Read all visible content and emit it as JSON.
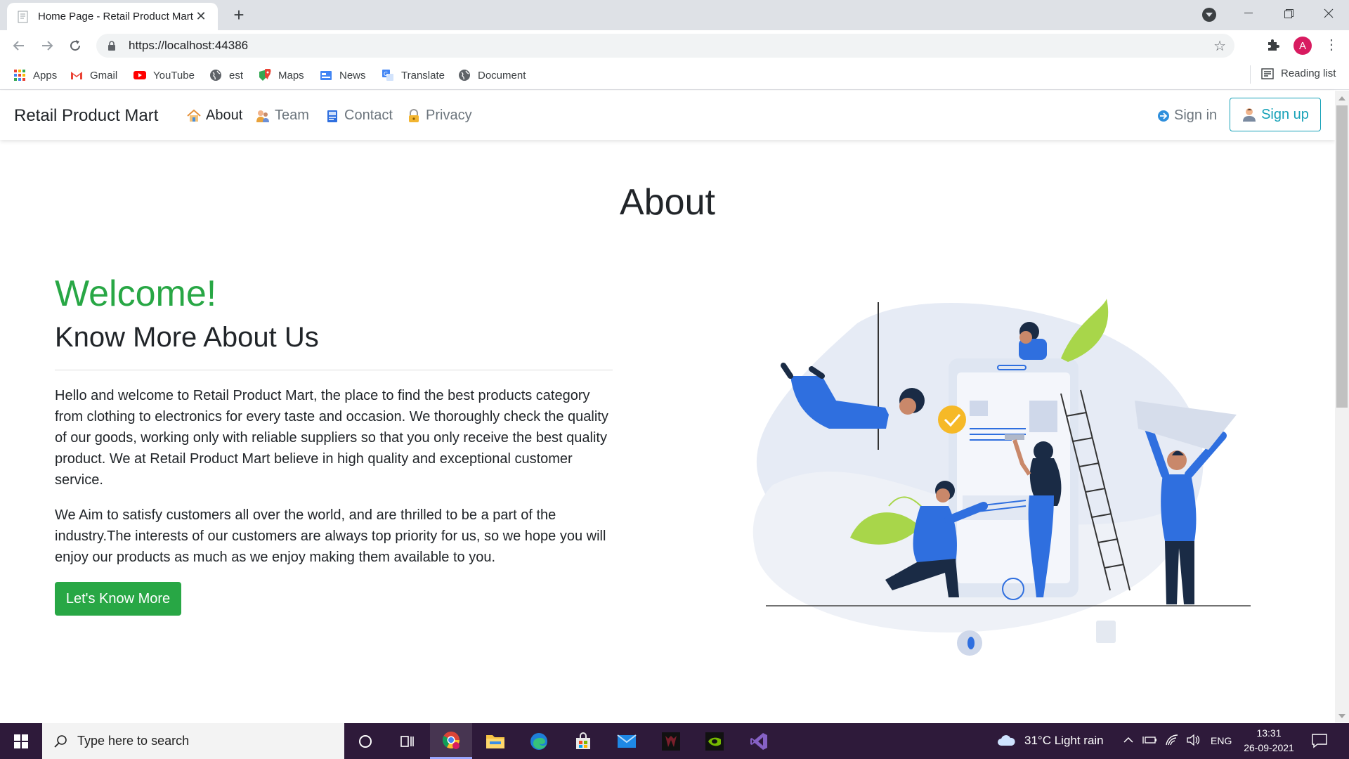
{
  "browser": {
    "tab_title": "Home Page - Retail Product Mart",
    "url": "https://localhost:44386",
    "profile_initial": "A",
    "bookmarks": [
      {
        "label": "Apps",
        "icon": "apps-grid-icon"
      },
      {
        "label": "Gmail",
        "icon": "gmail-icon"
      },
      {
        "label": "YouTube",
        "icon": "youtube-icon"
      },
      {
        "label": "est",
        "icon": "globe-icon"
      },
      {
        "label": "Maps",
        "icon": "maps-icon"
      },
      {
        "label": "News",
        "icon": "news-icon"
      },
      {
        "label": "Translate",
        "icon": "translate-icon"
      },
      {
        "label": "Document",
        "icon": "globe-icon"
      }
    ],
    "reading_list": "Reading list"
  },
  "site": {
    "brand": "Retail Product Mart",
    "nav": [
      {
        "label": "About",
        "icon": "home-icon",
        "active": true
      },
      {
        "label": "Team",
        "icon": "team-icon",
        "active": false
      },
      {
        "label": "Contact",
        "icon": "contact-icon",
        "active": false
      },
      {
        "label": "Privacy",
        "icon": "lock-icon",
        "active": false
      }
    ],
    "sign_in": "Sign in",
    "sign_up": "Sign up"
  },
  "content": {
    "page_title": "About",
    "welcome": "Welcome!",
    "subheading": "Know More About Us",
    "paragraph_1": "Hello and welcome to Retail Product Mart, the place to find the best products category from clothing to electronics for every taste and occasion. We thoroughly check the quality of our goods, working only with reliable suppliers so that you only receive the best quality product. We at Retail Product Mart believe in high quality and exceptional customer service.",
    "paragraph_2": "We Aim to satisfy customers all over the world, and are thrilled to be a part of the industry.The interests of our customers are always top priority for us, so we hope you will enjoy our products as much as we enjoy making them available to you.",
    "cta_label": "Let's Know More"
  },
  "taskbar": {
    "search_placeholder": "Type here to search",
    "weather": "31°C  Light rain",
    "language": "ENG",
    "time": "13:31",
    "date": "26-09-2021"
  },
  "colors": {
    "brand_green": "#28a745",
    "signup_teal": "#17a2b8",
    "taskbar_bg": "#2e1a3a",
    "illustration_blue": "#2f6fdf"
  }
}
